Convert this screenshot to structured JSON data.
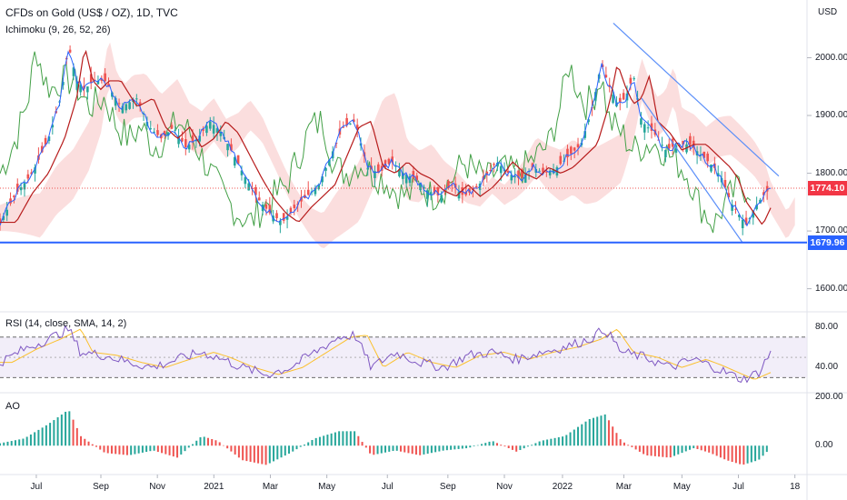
{
  "title": "CFDs on Gold (US$ / OZ), 1D, TVC",
  "currency_label": "USD",
  "colors": {
    "price_up": "#26a69a",
    "price_down": "#ef5350",
    "tenkan": "#2962ff",
    "kijun": "#b71c1c",
    "lagging": "#43a047",
    "cloud_bull": "#a5d6a7",
    "cloud_bear": "#f7b6b6",
    "support_line": "#2962ff",
    "channel_line": "#5b8ff9",
    "rsi_line": "#7e57c2",
    "rsi_ma": "#fbc02d",
    "rsi_band": "#ede7f6",
    "ao_up": "#26a69a",
    "ao_down": "#ef5350",
    "current_price_tag": "#f23645",
    "support_price_tag": "#2962ff"
  },
  "chart_data": [
    {
      "type": "line",
      "panel": "price",
      "series_label": "Ichimoku (9, 26, 52, 26)",
      "ylim": [
        1560,
        2100
      ],
      "y_ticks": [
        "2000.00",
        "1900.00",
        "1800.00",
        "1700.00",
        "1600.00"
      ],
      "y_tick_values": [
        2000,
        1900,
        1800,
        1700,
        1600
      ],
      "x_tick_labels": [
        "Jul",
        "Sep",
        "Nov",
        "2021",
        "Mar",
        "May",
        "Jul",
        "Sep",
        "Nov",
        "2022",
        "Mar",
        "May",
        "Jul",
        "18"
      ],
      "x_tick_positions": [
        0.045,
        0.125,
        0.195,
        0.265,
        0.335,
        0.405,
        0.48,
        0.555,
        0.625,
        0.697,
        0.773,
        0.845,
        0.915,
        0.985
      ],
      "close_path": [
        [
          0.0,
          1715
        ],
        [
          0.02,
          1765
        ],
        [
          0.04,
          1800
        ],
        [
          0.06,
          1860
        ],
        [
          0.075,
          1930
        ],
        [
          0.085,
          2020
        ],
        [
          0.095,
          1960
        ],
        [
          0.105,
          1945
        ],
        [
          0.115,
          1960
        ],
        [
          0.13,
          1960
        ],
        [
          0.15,
          1915
        ],
        [
          0.17,
          1930
        ],
        [
          0.185,
          1880
        ],
        [
          0.2,
          1860
        ],
        [
          0.215,
          1880
        ],
        [
          0.23,
          1845
        ],
        [
          0.245,
          1860
        ],
        [
          0.26,
          1890
        ],
        [
          0.275,
          1870
        ],
        [
          0.29,
          1830
        ],
        [
          0.305,
          1790
        ],
        [
          0.32,
          1755
        ],
        [
          0.335,
          1730
        ],
        [
          0.35,
          1715
        ],
        [
          0.365,
          1740
        ],
        [
          0.38,
          1760
        ],
        [
          0.395,
          1780
        ],
        [
          0.41,
          1830
        ],
        [
          0.425,
          1880
        ],
        [
          0.44,
          1890
        ],
        [
          0.455,
          1810
        ],
        [
          0.47,
          1800
        ],
        [
          0.485,
          1820
        ],
        [
          0.5,
          1800
        ],
        [
          0.515,
          1790
        ],
        [
          0.53,
          1770
        ],
        [
          0.545,
          1760
        ],
        [
          0.56,
          1780
        ],
        [
          0.575,
          1760
        ],
        [
          0.59,
          1775
        ],
        [
          0.6,
          1790
        ],
        [
          0.615,
          1820
        ],
        [
          0.63,
          1800
        ],
        [
          0.645,
          1790
        ],
        [
          0.66,
          1810
        ],
        [
          0.675,
          1800
        ],
        [
          0.69,
          1810
        ],
        [
          0.705,
          1830
        ],
        [
          0.72,
          1850
        ],
        [
          0.735,
          1920
        ],
        [
          0.745,
          1990
        ],
        [
          0.755,
          1950
        ],
        [
          0.765,
          1920
        ],
        [
          0.775,
          1930
        ],
        [
          0.785,
          1970
        ],
        [
          0.795,
          1890
        ],
        [
          0.81,
          1870
        ],
        [
          0.825,
          1840
        ],
        [
          0.84,
          1850
        ],
        [
          0.855,
          1850
        ],
        [
          0.87,
          1830
        ],
        [
          0.885,
          1810
        ],
        [
          0.895,
          1790
        ],
        [
          0.905,
          1750
        ],
        [
          0.915,
          1730
        ],
        [
          0.925,
          1710
        ],
        [
          0.935,
          1740
        ],
        [
          0.945,
          1760
        ],
        [
          0.955,
          1775
        ]
      ],
      "current_price": "1774.10",
      "support_level": "1679.96",
      "support_value": 1679.96,
      "current_value": 1774.1,
      "channel_upper": [
        [
          0.76,
          2060
        ],
        [
          0.965,
          1795
        ]
      ],
      "channel_lower": [
        [
          0.795,
          1930
        ],
        [
          0.92,
          1680
        ]
      ]
    },
    {
      "type": "line",
      "panel": "rsi",
      "series_label": "RSI (14, close, SMA, 14, 2)",
      "ylim": [
        15,
        95
      ],
      "y_ticks": [
        "80.00",
        "40.00"
      ],
      "y_tick_values": [
        80,
        40
      ],
      "band": [
        30,
        70
      ],
      "mid": 50,
      "rsi_path": [
        [
          0.0,
          45
        ],
        [
          0.03,
          58
        ],
        [
          0.06,
          68
        ],
        [
          0.085,
          78
        ],
        [
          0.1,
          55
        ],
        [
          0.13,
          52
        ],
        [
          0.16,
          45
        ],
        [
          0.19,
          40
        ],
        [
          0.22,
          48
        ],
        [
          0.25,
          55
        ],
        [
          0.27,
          50
        ],
        [
          0.3,
          40
        ],
        [
          0.33,
          33
        ],
        [
          0.36,
          40
        ],
        [
          0.39,
          55
        ],
        [
          0.42,
          70
        ],
        [
          0.44,
          72
        ],
        [
          0.46,
          40
        ],
        [
          0.49,
          55
        ],
        [
          0.52,
          45
        ],
        [
          0.55,
          40
        ],
        [
          0.58,
          52
        ],
        [
          0.61,
          55
        ],
        [
          0.64,
          48
        ],
        [
          0.67,
          55
        ],
        [
          0.7,
          60
        ],
        [
          0.73,
          68
        ],
        [
          0.75,
          78
        ],
        [
          0.77,
          55
        ],
        [
          0.8,
          50
        ],
        [
          0.83,
          40
        ],
        [
          0.86,
          48
        ],
        [
          0.88,
          42
        ],
        [
          0.9,
          35
        ],
        [
          0.92,
          28
        ],
        [
          0.94,
          35
        ],
        [
          0.955,
          55
        ]
      ]
    },
    {
      "type": "bar",
      "panel": "ao",
      "series_label": "AO",
      "ylim": [
        -120,
        220
      ],
      "y_ticks": [
        "200.00",
        "0.00"
      ],
      "y_tick_values": [
        200,
        0
      ],
      "ao_path": [
        [
          0.0,
          10
        ],
        [
          0.03,
          30
        ],
        [
          0.06,
          90
        ],
        [
          0.085,
          150
        ],
        [
          0.1,
          40
        ],
        [
          0.13,
          -30
        ],
        [
          0.16,
          -40
        ],
        [
          0.19,
          -20
        ],
        [
          0.22,
          -50
        ],
        [
          0.25,
          40
        ],
        [
          0.27,
          20
        ],
        [
          0.3,
          -60
        ],
        [
          0.33,
          -80
        ],
        [
          0.36,
          -30
        ],
        [
          0.39,
          30
        ],
        [
          0.42,
          60
        ],
        [
          0.44,
          60
        ],
        [
          0.46,
          -40
        ],
        [
          0.49,
          -20
        ],
        [
          0.52,
          -40
        ],
        [
          0.55,
          -20
        ],
        [
          0.58,
          -10
        ],
        [
          0.61,
          20
        ],
        [
          0.64,
          -25
        ],
        [
          0.67,
          20
        ],
        [
          0.7,
          40
        ],
        [
          0.73,
          110
        ],
        [
          0.75,
          130
        ],
        [
          0.77,
          20
        ],
        [
          0.8,
          -40
        ],
        [
          0.83,
          -50
        ],
        [
          0.86,
          -10
        ],
        [
          0.88,
          -30
        ],
        [
          0.9,
          -60
        ],
        [
          0.92,
          -80
        ],
        [
          0.94,
          -60
        ],
        [
          0.955,
          -10
        ]
      ]
    }
  ]
}
